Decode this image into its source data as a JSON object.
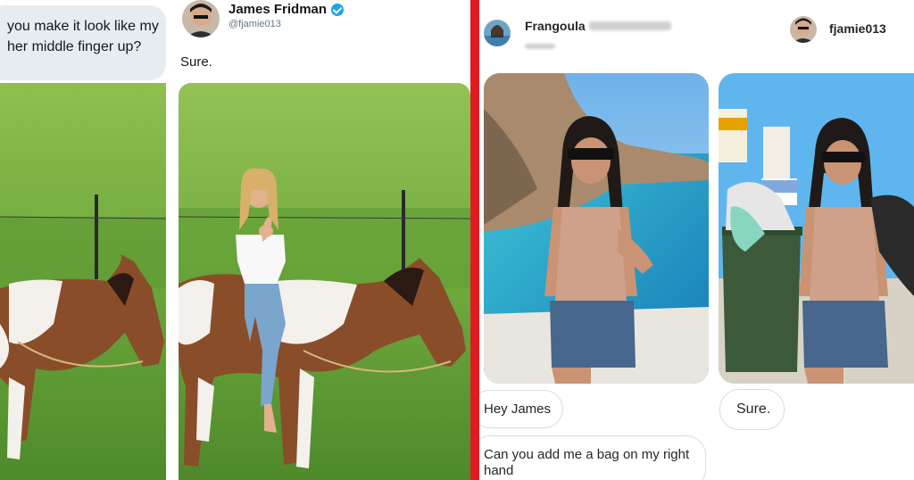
{
  "left_panel": {
    "question_text": "you make it look like my\nher middle finger up?",
    "tweet_author": {
      "name": "James Fridman",
      "handle": "@fjamie013",
      "verified_icon": "verified-badge-icon"
    },
    "reply_text": "Sure."
  },
  "right_panel": {
    "requester": {
      "name": "Frangoula",
      "name_blurred": "Christine Diak"
    },
    "responder": {
      "username": "fjamie013"
    },
    "messages": [
      {
        "text": "Hey James"
      },
      {
        "text": "Can you add me a bag on my right hand"
      },
      {
        "text": "Sure."
      }
    ]
  },
  "colors": {
    "divider": "#e11b22",
    "verified": "#1da1f2",
    "tweet_bubble": "#e6ecf0"
  }
}
